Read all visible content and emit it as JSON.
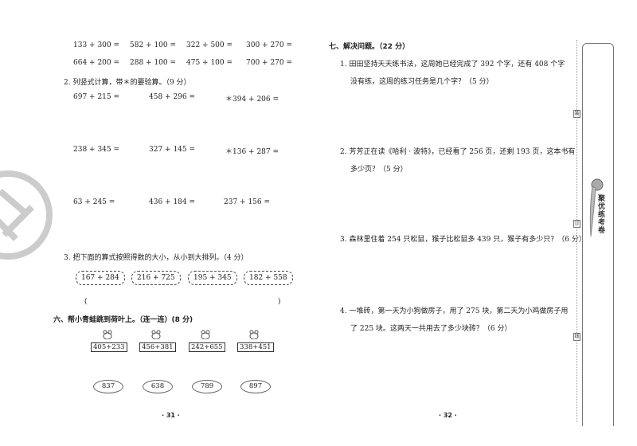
{
  "left_page": {
    "mental_math": [
      [
        "133 + 300 =",
        "582 + 100 =",
        "322 + 500 =",
        "300 + 270 ="
      ],
      [
        "664 + 200 =",
        "288 + 100 =",
        "475 + 100 =",
        "700 + 270 ="
      ]
    ],
    "q2_title": "2. 列竖式计算，带＊的要验算。（9 分）",
    "vertical_calc": [
      [
        "697 + 215 =",
        "458 + 296 =",
        "＊394 + 206 ="
      ],
      [
        "238 + 345 =",
        "327 + 145 =",
        "＊136 + 287 ="
      ],
      [
        "63 + 245 =",
        "436 + 184 =",
        "237 + 156 ="
      ]
    ],
    "q3_title": "3. 把下面的算式按照得数的大小，从小到大排列。（4 分）",
    "sort_items": [
      "167 + 284",
      "216 + 725",
      "195 + 345",
      "182 + 558"
    ],
    "paren_open": "(",
    "paren_close": ")",
    "section6_title": "六、帮小青蛙跳到荷叶上。（连一连）(8 分)",
    "frog_equations": [
      "405+233",
      "456+381",
      "242+655",
      "338+451"
    ],
    "lily_pads": [
      "837",
      "638",
      "789",
      "897"
    ],
    "page_number": "· 31 ·"
  },
  "right_page": {
    "section7_title": "七、解决问题。（22 分）",
    "problems": [
      {
        "line1": "1. 田田坚持天天练书法，这周她已经完成了 392 个字，还有 408 个字",
        "line2": "没有练，这周的练习任务是几个字？（5 分）"
      },
      {
        "line1": "2. 芳芳正在读《哈利 · 波特》，已经看了 256 页，还剩 193 页，这本书有",
        "line2": "多少页？（5 分）"
      },
      {
        "line1": "3. 森林里住着 254 只松鼠，猴子比松鼠多 439 只，猴子有多少只？（6 分）",
        "line2": ""
      },
      {
        "line1": "4. 一堆砖，第一天为小狗做房子，用了 275 块，第二天为小鸡做房子用",
        "line2": "了 225 块。这两天一共用去了多少块砖？（6 分）"
      }
    ],
    "page_number": "· 32 ·"
  },
  "binding": {
    "marks": [
      "装",
      "订",
      "线"
    ],
    "banner": "聚优练考卷"
  },
  "watermark": "密"
}
